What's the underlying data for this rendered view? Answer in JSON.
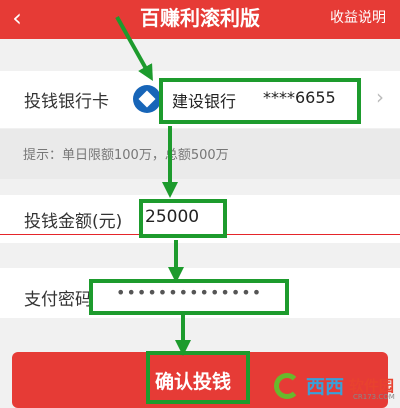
{
  "header": {
    "back_icon": "‹",
    "title": "百赚利滚利版",
    "link": "收益说明"
  },
  "card_row": {
    "label": "投钱银行卡",
    "bank_icon": "ccb-bank-logo",
    "bank_name": "建设银行",
    "card_mask": "****6655",
    "chevron": "›"
  },
  "tip": "提示：单日限额100万，总额500万",
  "amount_row": {
    "label": "投钱金额(元)",
    "value": "25000"
  },
  "password_row": {
    "label": "支付密码",
    "value": "••••••••••••••"
  },
  "confirm_button": "确认投钱",
  "watermark": {
    "text": "西西",
    "soft": "软件园",
    "url": "CR173.COM"
  },
  "colors": {
    "header_red": "#e63b36",
    "highlight_green": "#1d9b2d",
    "bank_blue": "#1765b8"
  }
}
